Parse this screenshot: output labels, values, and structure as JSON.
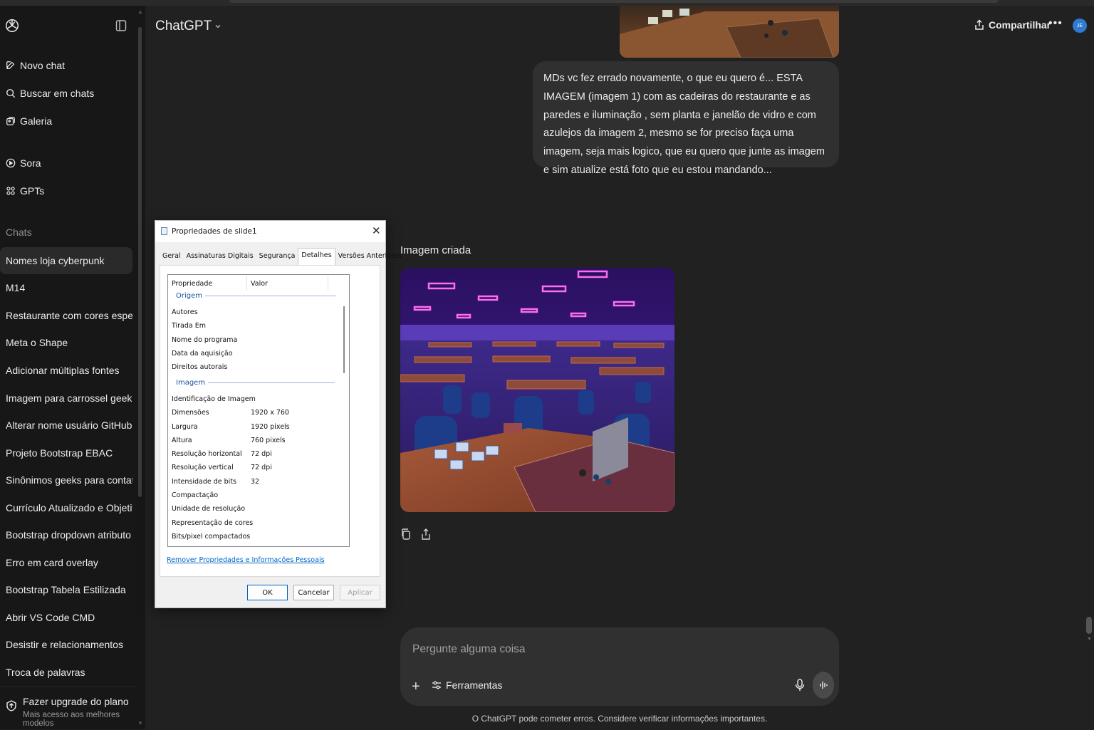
{
  "app": {
    "title": "ChatGPT",
    "share_label": "Compartilhar",
    "avatar_initials": "JE"
  },
  "sidebar": {
    "nav": [
      {
        "label": "Novo chat",
        "icon": "edit-icon"
      },
      {
        "label": "Buscar em chats",
        "icon": "search-icon"
      },
      {
        "label": "Galeria",
        "icon": "gallery-icon"
      },
      {
        "label": "Sora",
        "icon": "play-circle-icon"
      },
      {
        "label": "GPTs",
        "icon": "grid-icon"
      }
    ],
    "section_label": "Chats",
    "chats": [
      "Nomes loja cyberpunk",
      "M14",
      "Restaurante com cores especifi...",
      "Meta o Shape",
      "Adicionar múltiplas fontes",
      "Imagem para carrossel geek",
      "Alterar nome usuário GitHub",
      "Projeto Bootstrap EBAC",
      "Sinônimos geeks para contato",
      "Currículo Atualizado e Objetivo",
      "Bootstrap dropdown atributo",
      "Erro em card overlay",
      "Bootstrap Tabela Estilizada",
      "Abrir VS Code CMD",
      "Desistir e relacionamentos",
      "Troca de palavras"
    ],
    "upgrade": {
      "title": "Fazer upgrade do plano",
      "subtitle": "Mais acesso aos melhores modelos"
    }
  },
  "conversation": {
    "user_message": "MDs vc fez errado novamente, o que eu quero é... ESTA IMAGEM (imagem 1) com as cadeiras do restaurante e as paredes e iluminação , sem planta e janelão de vidro e com azulejos da imagem 2, mesmo se for preciso faça uma imagem, seja mais logico, que eu quero que junte as imagem e sim atualize está foto que eu estou mandando...",
    "image_label": "Imagem criada"
  },
  "composer": {
    "placeholder": "Pergunte alguma coisa",
    "tools_label": "Ferramentas"
  },
  "footer": "O ChatGPT pode cometer erros. Considere verificar informações importantes.",
  "dialog": {
    "title": "Propriedades de slide1",
    "tabs": [
      "Geral",
      "Assinaturas Digitais",
      "Segurança",
      "Detalhes",
      "Versões Anteriores"
    ],
    "active_tab": "Detalhes",
    "columns": [
      "Propriedade",
      "Valor"
    ],
    "group_origin": "Origem",
    "origin_rows": [
      {
        "prop": "Autores",
        "value": ""
      },
      {
        "prop": "Tirada Em",
        "value": ""
      },
      {
        "prop": "Nome do programa",
        "value": ""
      },
      {
        "prop": "Data da aquisição",
        "value": ""
      },
      {
        "prop": "Direitos autorais",
        "value": ""
      }
    ],
    "group_image": "Imagem",
    "image_rows": [
      {
        "prop": "Identificação de Imagem",
        "value": ""
      },
      {
        "prop": "Dimensões",
        "value": "1920 x 760"
      },
      {
        "prop": "Largura",
        "value": "1920 pixels"
      },
      {
        "prop": "Altura",
        "value": "760 pixels"
      },
      {
        "prop": "Resolução horizontal",
        "value": "72 dpi"
      },
      {
        "prop": "Resolução vertical",
        "value": "72 dpi"
      },
      {
        "prop": "Intensidade de bits",
        "value": "32"
      },
      {
        "prop": "Compactação",
        "value": ""
      },
      {
        "prop": "Unidade de resolução",
        "value": ""
      },
      {
        "prop": "Representação de cores",
        "value": ""
      },
      {
        "prop": "Bits/pixel compactados",
        "value": ""
      }
    ],
    "remove_link": "Remover Propriedades e Informações Pessoais",
    "buttons": {
      "ok": "OK",
      "cancel": "Cancelar",
      "apply": "Aplicar"
    }
  },
  "colors": {
    "background": "#212121",
    "sidebar": "#171717",
    "bubble": "#303030",
    "accent_avatar": "#2f7bd0"
  }
}
